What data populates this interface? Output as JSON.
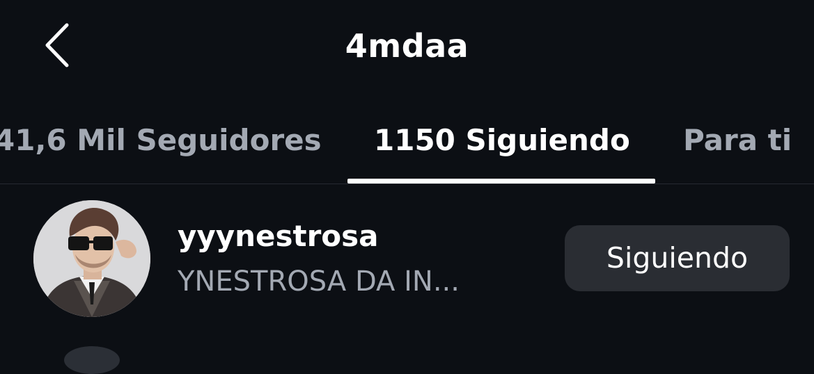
{
  "header": {
    "title": "4mdaa",
    "back_icon": "chevron-left-icon"
  },
  "tabs": [
    {
      "label": "41,6 Mil Seguidores",
      "active": false
    },
    {
      "label": "1150 Siguiendo",
      "active": true
    },
    {
      "label": "Para ti",
      "active": false
    }
  ],
  "list": {
    "items": [
      {
        "username": "yyynestrosa",
        "bio": "YNESTROSA DA IN...",
        "button_label": "Siguiendo"
      }
    ]
  },
  "colors": {
    "background": "#0c0f14",
    "text_primary": "#ffffff",
    "text_secondary": "#a3a9b3",
    "button_bg": "#2a2d33",
    "divider": "#262a31"
  }
}
